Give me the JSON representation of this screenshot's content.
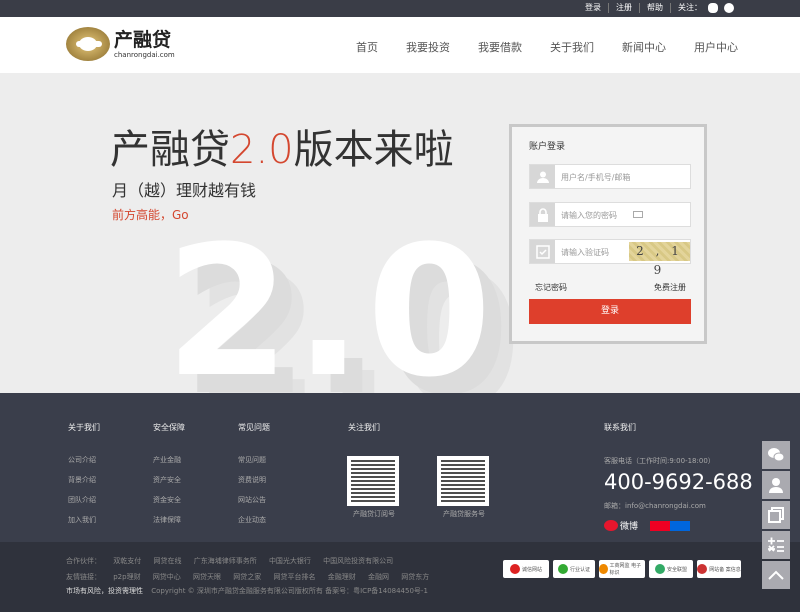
{
  "topbar": {
    "links": [
      "登录",
      "注册",
      "帮助",
      "关注："
    ],
    "icons": [
      "wechat-icon",
      "qq-icon"
    ]
  },
  "logo": {
    "cn": "产融贷",
    "en": "chanrongdai.com"
  },
  "nav": [
    "首页",
    "我要投资",
    "我要借款",
    "关于我们",
    "新闻中心",
    "用户中心"
  ],
  "hero": {
    "title_main": "产融贷",
    "title_ver": "2.0",
    "title_end": "版本来啦",
    "sub1": "月（越）理财越有钱",
    "sub2": "前方高能，Go",
    "big_text": "2.0"
  },
  "login": {
    "title": "账户登录",
    "username_placeholder": "用户名/手机号/邮箱",
    "password_placeholder": "请输入您的密码",
    "captcha_placeholder": "请输入验证码",
    "captcha_text": "2 , 1 9",
    "forgot": "忘记密码",
    "register": "免费注册",
    "submit": "登录"
  },
  "footer": {
    "columns": [
      {
        "title": "关于我们",
        "items": [
          "公司介绍",
          "背景介绍",
          "团队介绍",
          "加入我们"
        ]
      },
      {
        "title": "安全保障",
        "items": [
          "产业金融",
          "资产安全",
          "资金安全",
          "法律保障"
        ]
      },
      {
        "title": "常见问题",
        "items": [
          "常见问题",
          "资费说明",
          "网站公告",
          "企业动态"
        ]
      }
    ],
    "follow_title": "关注我们",
    "qr_labels": [
      "产融贷订阅号",
      "产融贷服务号"
    ],
    "contact": {
      "title": "联系我们",
      "hours": "客服电话（工作时间:9:00-18:00）",
      "phone": "400-9692-688",
      "mail": "邮箱：info@chanrongdai.com",
      "weibo": "微博"
    }
  },
  "bottom": {
    "partners_label": "合作伙伴：",
    "partners": [
      "双乾支付",
      "网贷在线",
      "广东海埔律师事务所",
      "中国光大银行",
      "中国风险投资有限公司"
    ],
    "links_label": "友情链接：",
    "links": [
      "p2p理财",
      "网贷中心",
      "网贷天眼",
      "网贷之家",
      "网贷平台排名",
      "金融理财",
      "金融网",
      "网贷东方"
    ],
    "risk": "市场有风险，投资需理性",
    "copyright": "Copyright © 深圳市产融贷金融服务有限公司版权所有 备案号：粤ICP备14084450号-1",
    "badges": [
      "诚信网站",
      "行业认证",
      "工商网监 电子标识",
      "安全联盟",
      "网站备 案信息"
    ]
  },
  "side": [
    "wechat-icon",
    "user-service-icon",
    "copy-icon",
    "calculator-icon",
    "back-to-top-icon"
  ]
}
